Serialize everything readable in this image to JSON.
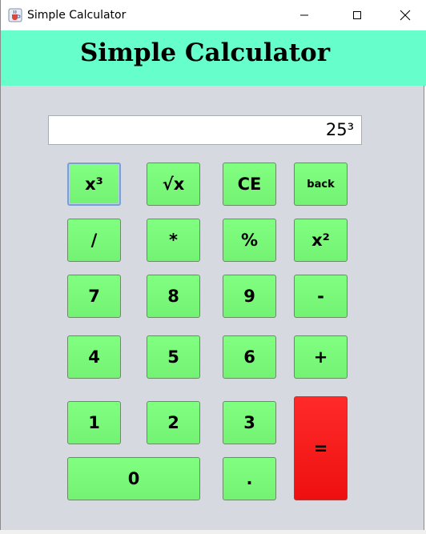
{
  "window": {
    "title": "Simple Calculator",
    "icons": {
      "app": "java-cup-icon",
      "minimize": "minimize-icon",
      "maximize": "maximize-icon",
      "close": "close-icon"
    }
  },
  "banner": {
    "title": "Simple Calculator",
    "background": "#66ffcc"
  },
  "display": {
    "value": "25³"
  },
  "buttons": {
    "cube": "x³",
    "sqrt": "√x",
    "clear_entry": "CE",
    "back": "back",
    "divide": "/",
    "multiply": "*",
    "percent": "%",
    "square": "x²",
    "seven": "7",
    "eight": "8",
    "nine": "9",
    "minus": "-",
    "four": "4",
    "five": "5",
    "six": "6",
    "plus": "+",
    "one": "1",
    "two": "2",
    "three": "3",
    "equals": "=",
    "zero": "0",
    "decimal": "."
  },
  "colors": {
    "button_green": "#80ff80",
    "equals_red": "#ff1a1a",
    "window_bg": "#d6d9e0"
  }
}
